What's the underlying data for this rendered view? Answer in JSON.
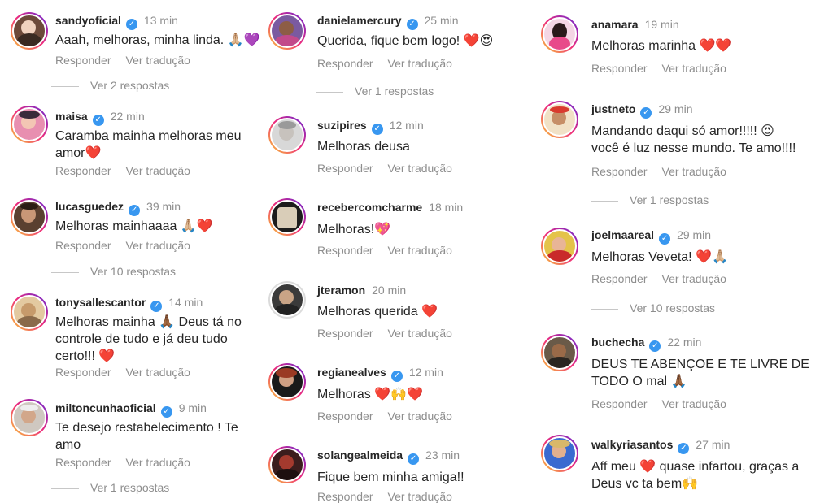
{
  "common": {
    "reply_label": "Responder",
    "translate_label": "Ver tradução",
    "verified_mark": "✓"
  },
  "columns": [
    {
      "comments": [
        {
          "username": "sandyoficial",
          "time": "13 min",
          "text": "Aaah, melhoras, minha linda. 🙏🏼💜",
          "verified": true,
          "replies": "Ver 2 respostas"
        },
        {
          "username": "maisa",
          "time": "22 min",
          "text": "Caramba mainha melhoras meu\namor❤️",
          "verified": true,
          "replies": ""
        },
        {
          "username": "lucasguedez",
          "time": "39 min",
          "text": "Melhoras mainhaaaa 🙏🏼❤️",
          "verified": true,
          "replies": "Ver 10 respostas"
        },
        {
          "username": "tonysallescantor",
          "time": "14 min",
          "text": "Melhoras mainha 🙏🏾 Deus tá no\ncontrole de tudo e já deu tudo\ncerto!!! ❤️",
          "verified": true,
          "replies": ""
        },
        {
          "username": "miltoncunhaoficial",
          "time": "9 min",
          "text": "Te desejo restabelecimento ! Te\namo",
          "verified": true,
          "replies": "Ver 1 respostas"
        }
      ]
    },
    {
      "comments": [
        {
          "username": "danielamercury",
          "time": "25 min",
          "text": "Querida, fique bem logo! ❤️😍",
          "verified": true,
          "replies": "Ver 1 respostas"
        },
        {
          "username": "suzipires",
          "time": "12 min",
          "text": "Melhoras deusa",
          "verified": true,
          "replies": ""
        },
        {
          "username": "recebercomcharme",
          "time": "18 min",
          "text": "Melhoras!💖",
          "verified": false,
          "replies": ""
        },
        {
          "username": "jteramon",
          "time": "20 min",
          "text": "Melhoras querida ❤️",
          "verified": false,
          "replies": ""
        },
        {
          "username": "regianealves",
          "time": "12 min",
          "text": "Melhoras ❤️🙌❤️",
          "verified": true,
          "replies": ""
        },
        {
          "username": "solangealmeida",
          "time": "23 min",
          "text": "Fique bem minha amiga!!",
          "verified": true,
          "replies": ""
        }
      ]
    },
    {
      "comments": [
        {
          "username": "anamara",
          "time": "19 min",
          "text": "Melhoras marinha ❤️❤️",
          "verified": false,
          "replies": ""
        },
        {
          "username": "justneto",
          "time": "29 min",
          "text": "Mandando daqui só amor!!!!! 😍\nvocê é luz nesse mundo. Te amo!!!!",
          "verified": true,
          "replies": "Ver 1 respostas"
        },
        {
          "username": "joelmaareal",
          "time": "29 min",
          "text": "Melhoras Veveta! ❤️🙏🏼",
          "verified": true,
          "replies": "Ver 10 respostas"
        },
        {
          "username": "buchecha",
          "time": "22 min",
          "text": "DEUS TE ABENÇOE E TE LIVRE DE\nTODO O mal 🙏🏾",
          "verified": true,
          "replies": ""
        },
        {
          "username": "walkyriasantos",
          "time": "27 min",
          "text": "Aff meu ❤️ quase infartou, graças a\nDeus vc ta bem🙌",
          "verified": true,
          "replies": ""
        }
      ]
    }
  ]
}
